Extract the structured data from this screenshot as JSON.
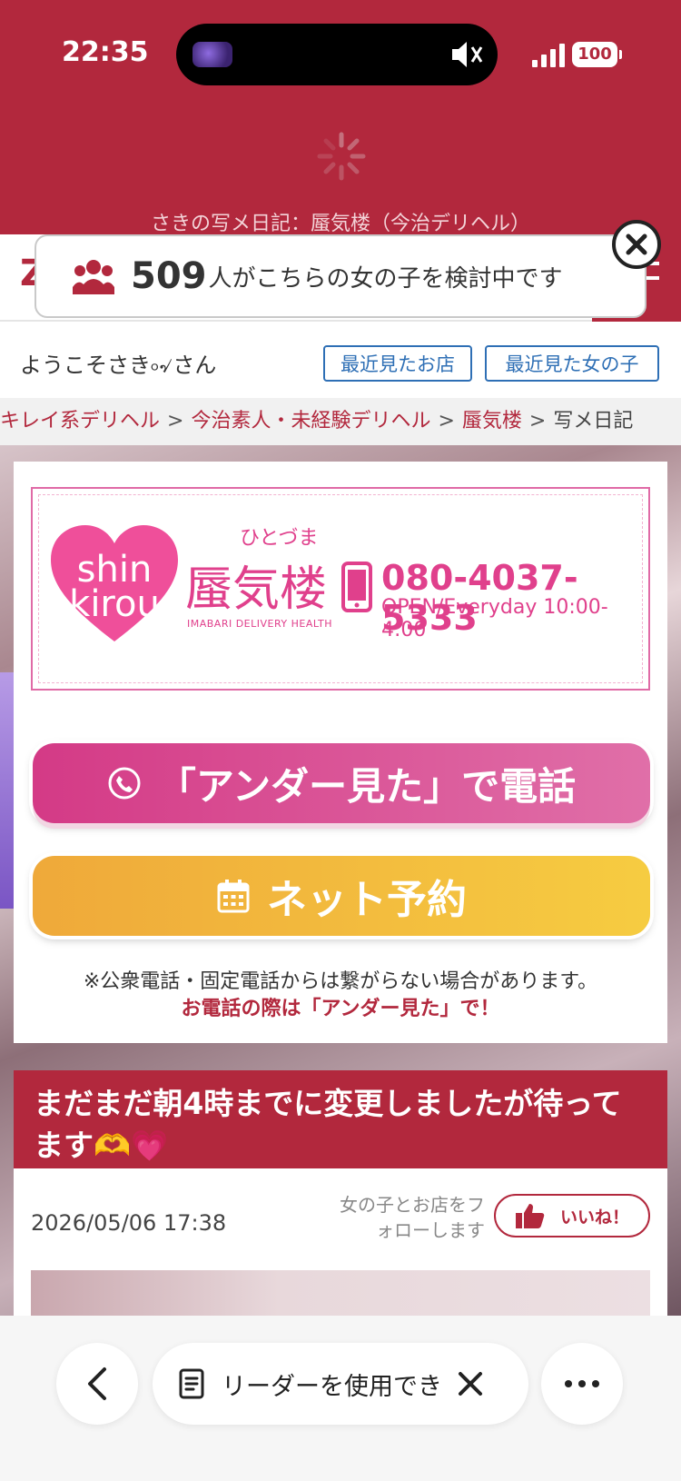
{
  "status_bar": {
    "time": "22:35",
    "battery": "100"
  },
  "page_heading": "さきの写メ日記：蜃気楼（今治デリヘル）",
  "viewers": {
    "count": "509",
    "text": "人がこちらの女の子を検討中です"
  },
  "welcome": {
    "greeting": "ようこそさき৹৵さん",
    "recent_shops": "最近見たお店",
    "recent_girls": "最近見た女の子"
  },
  "breadcrumb": {
    "items": [
      "キレイ系デリヘル",
      "今治素人・未経験デリヘル",
      "蜃気楼"
    ],
    "current": "写メ日記",
    "separator": ">"
  },
  "banner": {
    "logo_text": "shin kirou",
    "ruby": "ひとづま",
    "shop_name": "蜃気楼",
    "subtitle": "IMABARI DELIVERY HEALTH",
    "phone": "080-4037-5333",
    "hours": "OPEN/Everyday 10:00-4:00"
  },
  "buttons": {
    "call": "「アンダー見た」で電話",
    "reserve": "ネット予約"
  },
  "notes": {
    "line1": "※公衆電話・固定電話からは繋がらない場合があります。",
    "line2": "お電話の際は「アンダー見た」で！"
  },
  "post": {
    "title": "まだまだ朝4時までに変更しましたが待ってます🫶💗",
    "date": "2026/05/06 17:38",
    "follow": "女の子とお店をフォローします",
    "like": "いいね！"
  },
  "toolbar": {
    "reader_text": "リーダーを使用できます"
  },
  "colors": {
    "brand": "#b2283d",
    "pink": "#e0408c",
    "link_blue": "#2e6fb5",
    "reserve": "#f2b63d"
  }
}
